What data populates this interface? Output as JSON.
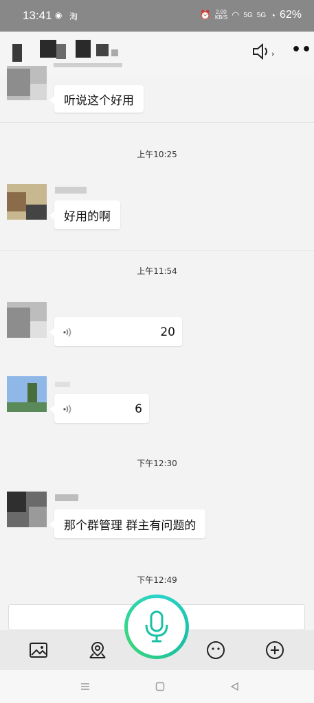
{
  "status": {
    "time": "13:41",
    "small_text": "淘",
    "net_speed_value": "2.00",
    "net_speed_unit": "KB/S",
    "sig1": "5G",
    "sig2": "5G",
    "battery": "62%"
  },
  "messages": [
    {
      "text": "听说这个好用"
    },
    {
      "text": "好用的啊"
    },
    {
      "duration": "20"
    },
    {
      "duration": "6"
    },
    {
      "text": "那个群管理 群主有问题的"
    }
  ],
  "timestamps": [
    "上午10:25",
    "上午11:54",
    "下午12:30",
    "下午12:49"
  ],
  "header": {
    "speaker_chevron": "›",
    "more_label": "•••"
  },
  "colors": {
    "accent_green": "#18c1a6",
    "status_bar": "#888888"
  },
  "icons": [
    "image-icon",
    "location-icon",
    "emoji-icon",
    "plus-icon",
    "mic-icon",
    "speaker-icon"
  ]
}
